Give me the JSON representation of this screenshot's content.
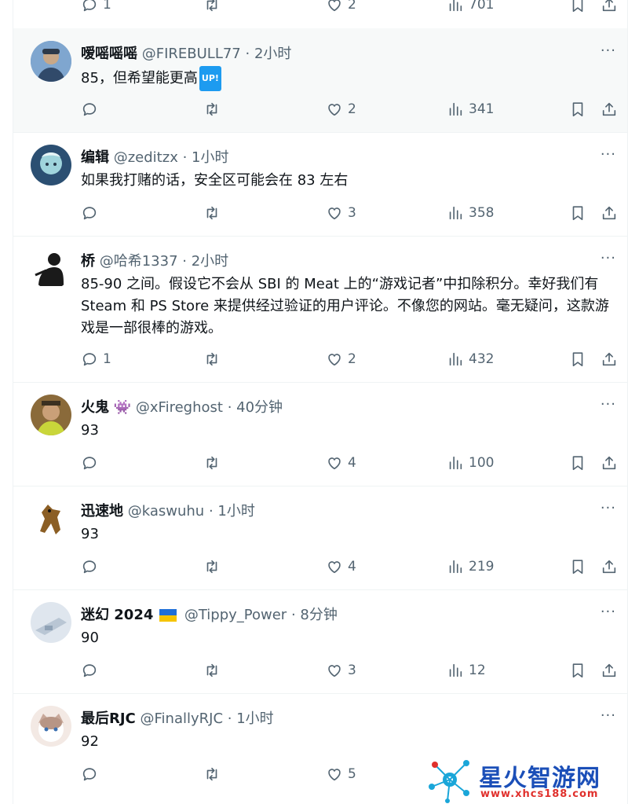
{
  "top_partial": {
    "reply": "1",
    "retweet": "",
    "like": "2",
    "views": "701"
  },
  "tweets": [
    {
      "name": "嗳嗂嗂嗂",
      "handle": "@FIREBULL77",
      "time": "· 2小时",
      "text": "85，但希望能更高",
      "badge": "UP!",
      "reply": "",
      "like": "2",
      "views": "341"
    },
    {
      "name": "编辑",
      "handle": "@zeditzx",
      "time": "· 1小时",
      "text": "如果我打赌的话，安全区可能会在 83 左右",
      "reply": "",
      "like": "3",
      "views": "358"
    },
    {
      "name": "桥",
      "handle": "@哈希1337",
      "time": "· 2小时",
      "text": "85-90 之间。假设它不会从 SBI 的 Meat 上的“游戏记者”中扣除积分。幸好我们有 Steam 和 PS Store 来提供经过验证的用户评论。不像您的网站。毫无疑问，这款游戏是一部很棒的游戏。",
      "reply": "1",
      "like": "2",
      "views": "432"
    },
    {
      "name": "火鬼",
      "handle": "@xFireghost",
      "time": "· 40分钟",
      "text": "93",
      "reply": "",
      "like": "4",
      "views": "100"
    },
    {
      "name": "迅速地",
      "handle": "@kaswuhu",
      "time": "· 1小时",
      "text": "93",
      "reply": "",
      "like": "4",
      "views": "219"
    },
    {
      "name": "迷幻 2024",
      "handle": "@Tippy_Power",
      "time": "· 8分钟",
      "text": "90",
      "reply": "",
      "like": "3",
      "views": "12"
    },
    {
      "name": "最后RJC",
      "handle": "@FinallyRJC",
      "time": "· 1小时",
      "text": "92",
      "reply": "",
      "like": "5",
      "views": ""
    }
  ],
  "more_label": "···",
  "watermark": {
    "title": "星火智游网",
    "url": "www.xhcs188.com"
  },
  "colors": {
    "text": "#0f1419",
    "secondary": "#536471",
    "border": "#eff3f4",
    "highlight": "#f7f9f9",
    "accent": "#1d9bf0"
  },
  "icons": [
    "reply-icon",
    "retweet-icon",
    "like-icon",
    "views-icon",
    "bookmark-icon",
    "share-icon",
    "more-icon"
  ]
}
